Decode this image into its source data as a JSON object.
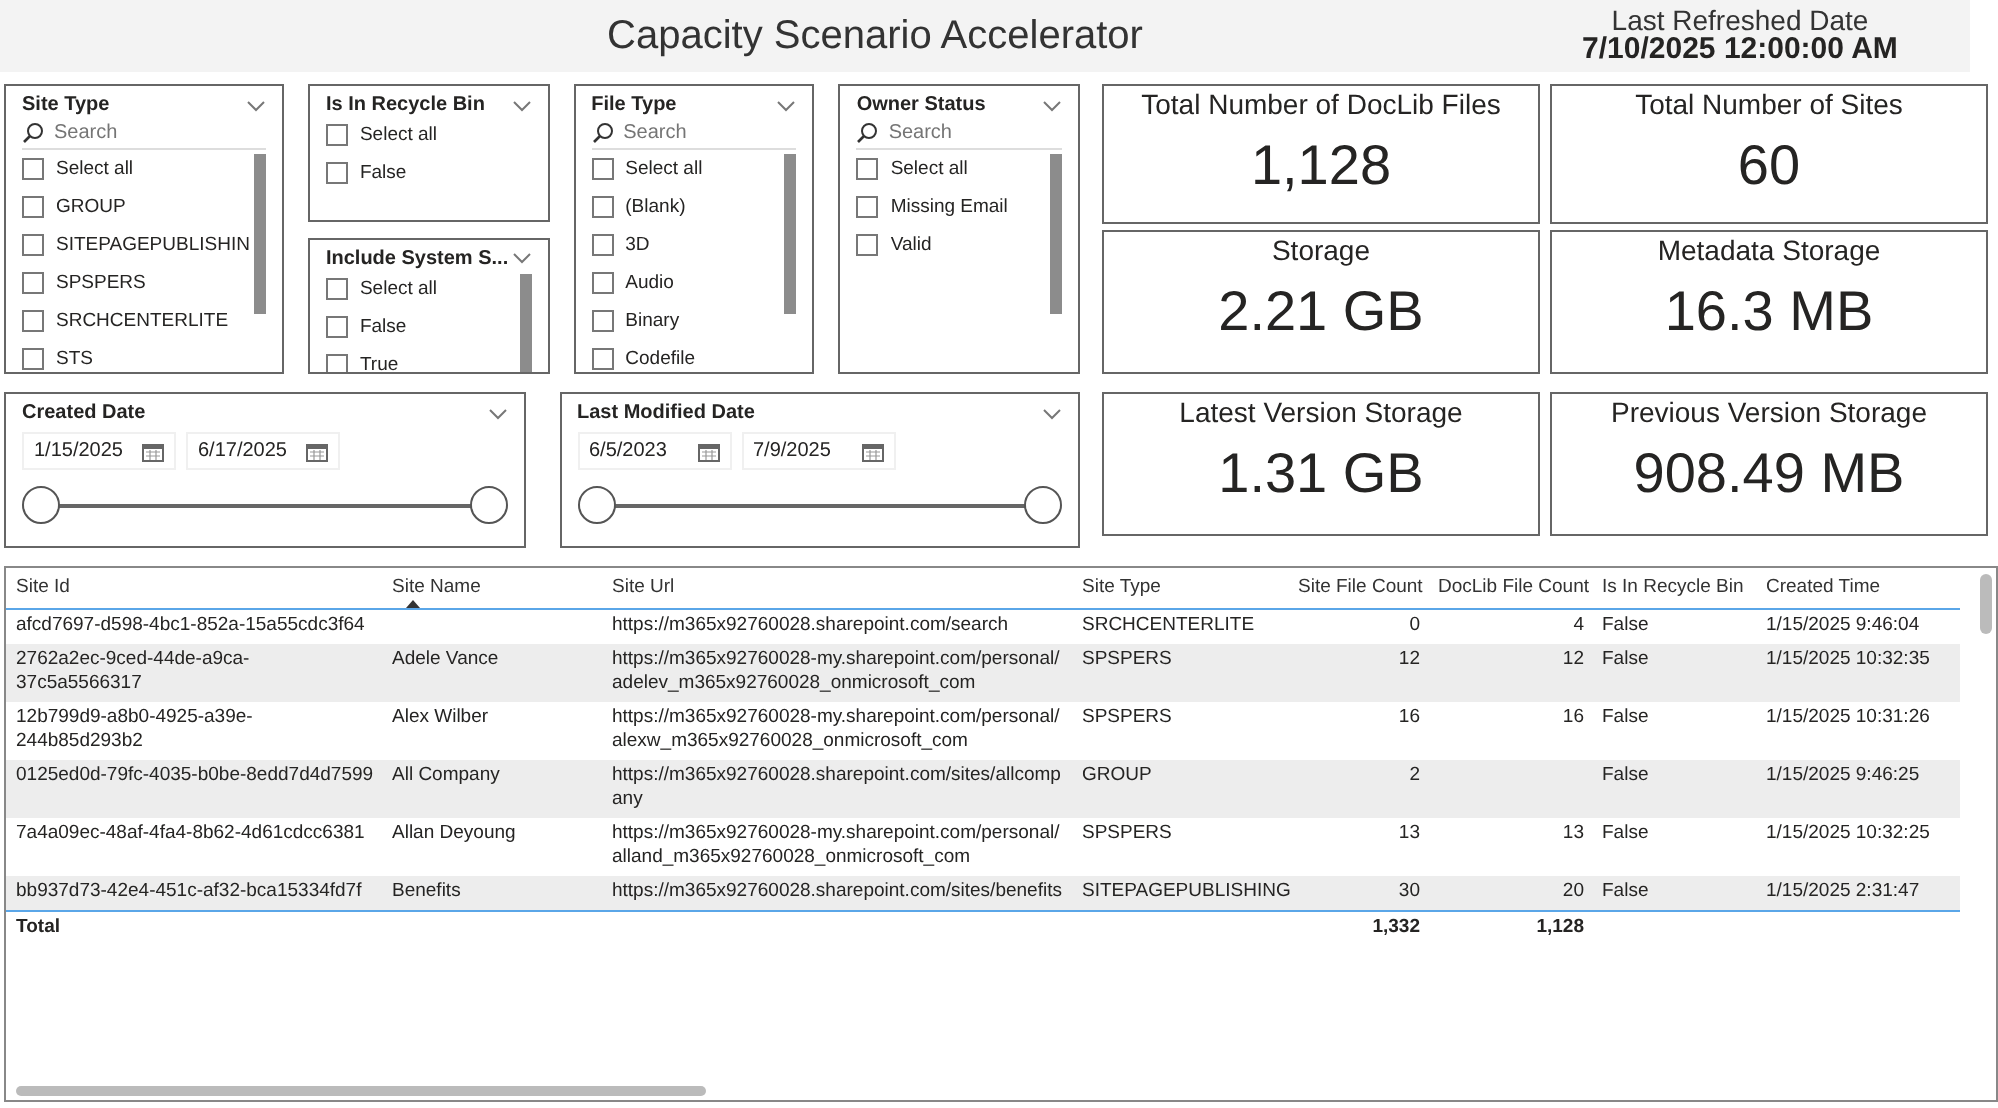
{
  "header": {
    "title": "Capacity Scenario Accelerator",
    "refresh_label": "Last Refreshed Date",
    "refresh_value": "7/10/2025 12:00:00 AM"
  },
  "slicer_columns": [
    [
      {
        "title": "Site Type",
        "placeholder": "Search",
        "items": [
          {
            "label": "Select all",
            "checked": false
          },
          {
            "label": "GROUP",
            "checked": false
          },
          {
            "label": "SITEPAGEPUBLISHIN",
            "checked": false
          },
          {
            "label": "SPSPERS",
            "checked": false
          },
          {
            "label": "SRCHCENTERLITE",
            "checked": false
          },
          {
            "label": "STS",
            "checked": false
          }
        ]
      }
    ],
    [
      {
        "title": "Is In Recycle Bin",
        "items": [
          {
            "label": "Select all",
            "checked": false
          },
          {
            "label": "False",
            "checked": false
          }
        ]
      },
      {
        "title": "Include System S...",
        "items": [
          {
            "label": "Select all",
            "checked": false
          },
          {
            "label": "False",
            "checked": false
          },
          {
            "label": "True",
            "checked": false
          }
        ]
      }
    ],
    [
      {
        "title": "File Type",
        "placeholder": "Search",
        "items": [
          {
            "label": "Select all",
            "checked": false
          },
          {
            "label": "(Blank)",
            "checked": false
          },
          {
            "label": "3D",
            "checked": false
          },
          {
            "label": "Audio",
            "checked": false
          },
          {
            "label": "Binary",
            "checked": false
          },
          {
            "label": "Codefile",
            "checked": false
          }
        ]
      }
    ],
    [
      {
        "title": "Owner Status",
        "placeholder": "Search",
        "items": [
          {
            "label": "Select all",
            "checked": false
          },
          {
            "label": "Missing Email",
            "checked": false
          },
          {
            "label": "Valid",
            "checked": false
          }
        ]
      }
    ]
  ],
  "date_slicers": [
    {
      "title": "Created Date",
      "start": "1/15/2025",
      "end": "6/17/2025"
    },
    {
      "title": "Last Modified Date",
      "start": "6/5/2023",
      "end": "7/9/2025"
    }
  ],
  "cards": [
    {
      "label": "Total Number of DocLib Files",
      "value": "1,128"
    },
    {
      "label": "Total Number of Sites",
      "value": "60"
    },
    {
      "label": "Storage",
      "value": "2.21 GB"
    },
    {
      "label": "Metadata Storage",
      "value": "16.3 MB"
    },
    {
      "label": "Latest Version Storage",
      "value": "1.31 GB"
    },
    {
      "label": "Previous Version Storage",
      "value": "908.49 MB"
    }
  ],
  "table": {
    "columns": [
      {
        "label": "Site Id",
        "sorted": false,
        "kind": "text"
      },
      {
        "label": "Site Name",
        "sorted": true,
        "kind": "text"
      },
      {
        "label": "Site Url",
        "sorted": false,
        "kind": "text"
      },
      {
        "label": "Site Type",
        "sorted": false,
        "kind": "text"
      },
      {
        "label": "Site File Count",
        "sorted": false,
        "kind": "number"
      },
      {
        "label": "DocLib File Count",
        "sorted": false,
        "kind": "number"
      },
      {
        "label": "Is In Recycle Bin",
        "sorted": false,
        "kind": "text"
      },
      {
        "label": "Created Time",
        "sorted": false,
        "kind": "text"
      }
    ],
    "rows": [
      [
        "afcd7697-d598-4bc1-852a-15a55cdc3f64",
        null,
        "https://m365x92760028.sharepoint.com/search",
        "SRCHCENTERLITE",
        "0",
        "4",
        "False",
        "1/15/2025 9:46:04"
      ],
      [
        "2762a2ec-9ced-44de-a9ca-37c5a5566317",
        "Adele Vance",
        "https://m365x92760028-my.sharepoint.com/personal/adelev_m365x92760028_onmicrosoft_com",
        "SPSPERS",
        "12",
        "12",
        "False",
        "1/15/2025 10:32:35"
      ],
      [
        "12b799d9-a8b0-4925-a39e-244b85d293b2",
        "Alex Wilber",
        "https://m365x92760028-my.sharepoint.com/personal/alexw_m365x92760028_onmicrosoft_com",
        "SPSPERS",
        "16",
        "16",
        "False",
        "1/15/2025 10:31:26"
      ],
      [
        "0125ed0d-79fc-4035-b0be-8edd7d4d7599",
        "All Company",
        "https://m365x92760028.sharepoint.com/sites/allcompany",
        "GROUP",
        "2",
        null,
        "False",
        "1/15/2025 9:46:25"
      ],
      [
        "7a4a09ec-48af-4fa4-8b62-4d61cdcc6381",
        "Allan Deyoung",
        "https://m365x92760028-my.sharepoint.com/personal/alland_m365x92760028_onmicrosoft_com",
        "SPSPERS",
        "13",
        "13",
        "False",
        "1/15/2025 10:32:25"
      ],
      [
        "bb937d73-42e4-451c-af32-bca15334fd7f",
        "Benefits",
        "https://m365x92760028.sharepoint.com/sites/benefits",
        "SITEPAGEPUBLISHING",
        "30",
        "20",
        "False",
        "1/15/2025 2:31:47"
      ]
    ],
    "total": {
      "label": "Total",
      "site_file_count": "1,332",
      "doclib_file_count": "1,128"
    }
  }
}
